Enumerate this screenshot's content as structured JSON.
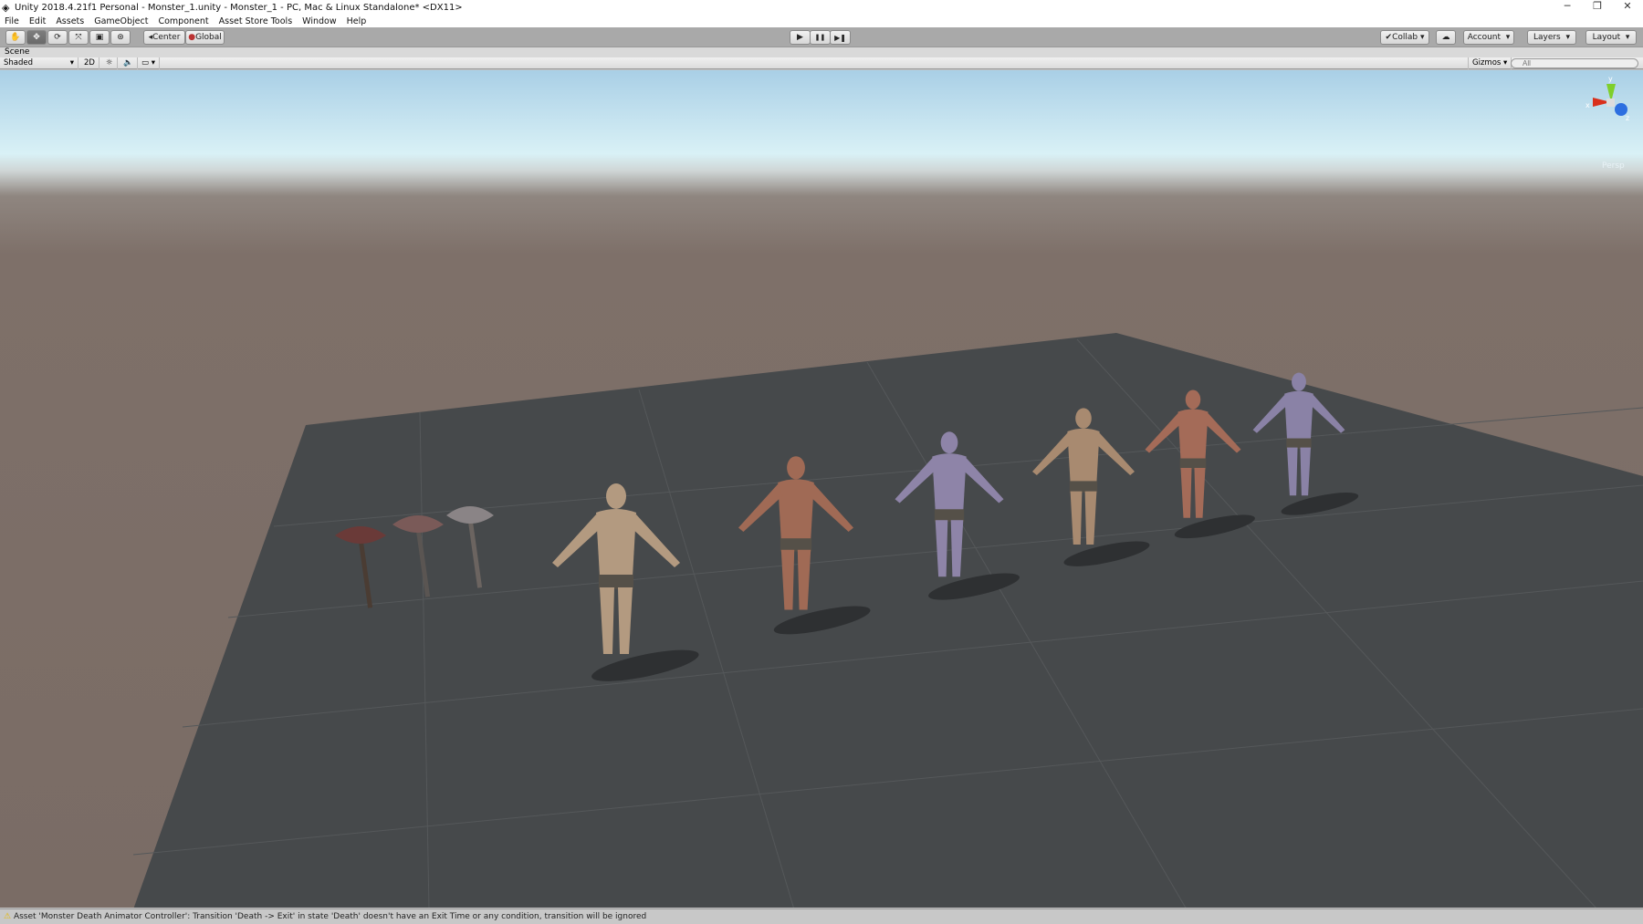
{
  "window": {
    "title": "Unity 2018.4.21f1 Personal - Monster_1.unity - Monster_1 - PC, Mac & Linux Standalone* <DX11>",
    "minimize": "─",
    "restore": "❐",
    "close": "✕"
  },
  "menu": [
    "File",
    "Edit",
    "Assets",
    "GameObject",
    "Component",
    "Asset Store Tools",
    "Window",
    "Help"
  ],
  "toolbar": {
    "tools": [
      "hand-tool",
      "move-tool",
      "rotate-tool",
      "scale-tool",
      "rect-tool",
      "transform-tool"
    ],
    "active_tool": "move-tool",
    "pivot": "Center",
    "space": "Global",
    "play": "▶",
    "pause": "❚❚",
    "step": "▶❚",
    "collab": "Collab",
    "account": "Account",
    "layers": "Layers",
    "layout": "Layout"
  },
  "scene": {
    "tab": "Scene",
    "shading": "Shaded",
    "mode_2d": "2D",
    "gizmos": "Gizmos",
    "search_placeholder": "All",
    "projection": "Persp",
    "axes": {
      "x": "x",
      "y": "y",
      "z": "z"
    }
  },
  "status": {
    "message": "Asset 'Monster Death Animator Controller': Transition 'Death -> Exit' in state 'Death' doesn't have an Exit Time or any condition, transition will be ignored"
  },
  "colors": {
    "axis_x": "#d9301c",
    "axis_y": "#7fcf2b",
    "axis_z": "#2d6fe0",
    "plane": "#46494b"
  }
}
